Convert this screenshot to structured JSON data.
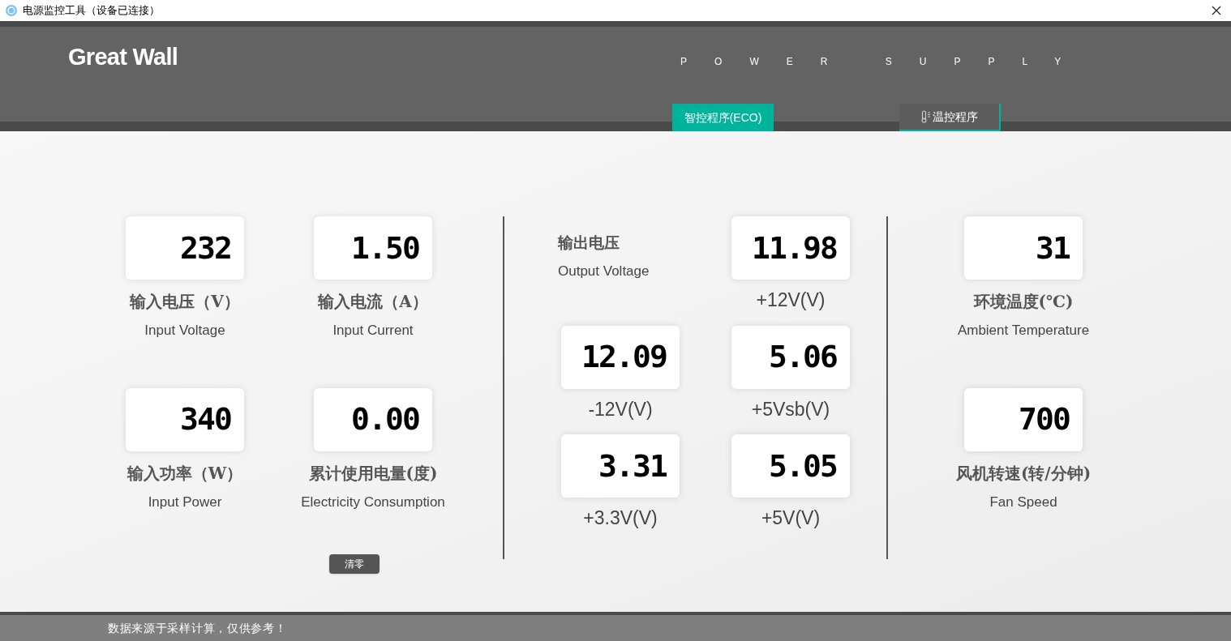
{
  "window": {
    "title": "电源监控工具（设备已连接）"
  },
  "header": {
    "logo": "Great Wall",
    "tagline": "POWER SUPPLY",
    "tabs": [
      {
        "label": "智控程序(ECO)",
        "selected": true,
        "kind": "plain"
      },
      {
        "label": "温控程序",
        "selected": false,
        "kind": "thermometer"
      }
    ]
  },
  "input_panel": {
    "readings": [
      {
        "value": "232",
        "label_zh": "输入电压（V）",
        "label_en": "Input Voltage"
      },
      {
        "value": "1.50",
        "label_zh": "输入电流（A）",
        "label_en": "Input Current"
      },
      {
        "value": "340",
        "label_zh": "输入功率（W）",
        "label_en": "Input Power"
      },
      {
        "value": "0.00",
        "label_zh": "累计使用电量(度)",
        "label_en": "Electricity Consumption"
      }
    ],
    "reset_button": "清零"
  },
  "output_panel": {
    "title_zh": "输出电压",
    "title_en": "Output Voltage",
    "readings": [
      {
        "value": "11.98",
        "label": "+12V(V)"
      },
      {
        "value": "12.09",
        "label": "-12V(V)"
      },
      {
        "value": "5.06",
        "label": "+5Vsb(V)"
      },
      {
        "value": "3.31",
        "label": "+3.3V(V)"
      },
      {
        "value": "5.05",
        "label": "+5V(V)"
      }
    ]
  },
  "environment_panel": {
    "readings": [
      {
        "value": "31",
        "label_zh": "环境温度(℃)",
        "label_en": "Ambient Temperature"
      },
      {
        "value": "700",
        "label_zh": "风机转速(转/分钟)",
        "label_en": "Fan Speed"
      }
    ]
  },
  "footer": {
    "note": "数据来源于采样计算，仅供参考！"
  }
}
